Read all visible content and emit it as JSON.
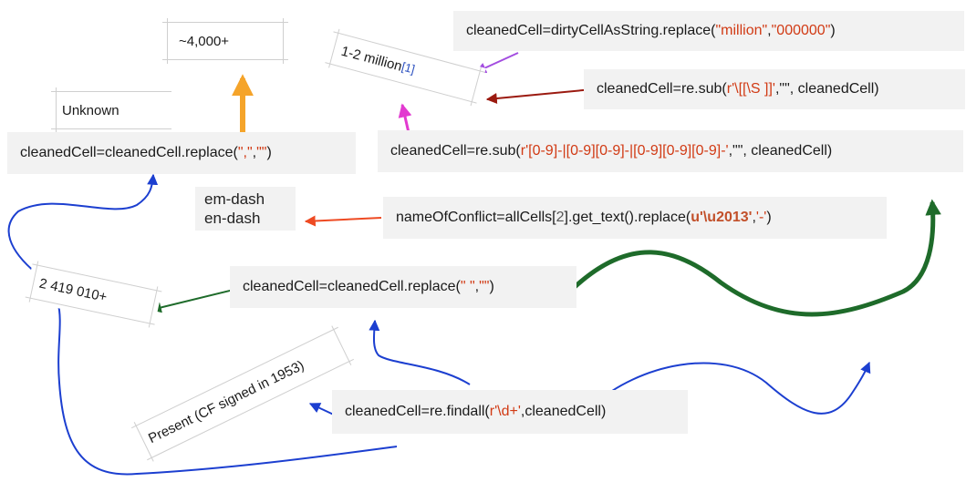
{
  "cells": {
    "approx": "~4,000+",
    "million": "1-2 million",
    "million_ref": "[1]",
    "unknown": "Unknown",
    "number": "2 419 010+",
    "present": "Present (CF signed in 1953)"
  },
  "dash_labels": {
    "em": "em-dash",
    "en": "en-dash"
  },
  "code": {
    "replace_million": {
      "pre": "cleanedCell=dirtyCellAsString.replace(",
      "a1": "\"million\"",
      "sep": ", ",
      "a2": "\"000000\"",
      "post": ")"
    },
    "re_sub_brackets": {
      "pre": "cleanedCell=re.sub(",
      "a1": "r'\\[[\\S ]]'",
      "sep": ",\"\", cleanedCell)"
    },
    "replace_comma": {
      "pre": "cleanedCell=cleanedCell.replace(",
      "a1": "\",\"",
      "sep": ", ",
      "a2": "\"\"",
      "post": ")"
    },
    "re_sub_digits": {
      "pre": "cleanedCell=re.sub(",
      "a1": "r'[0-9]-|[0-9][0-9]-|[0-9][0-9][0-9]-'",
      "sep": ",\"\", cleanedCell)"
    },
    "replace_dash": {
      "pre": "nameOfConflict=allCells[",
      "idx": "2",
      "mid": "].get_text().replace(",
      "a1": "u'\\u2013'",
      "sep": ", ",
      "a2": "'-'",
      "post": ")"
    },
    "replace_space": {
      "pre": "cleanedCell=cleanedCell.replace(",
      "a1": "\" \"",
      "sep": ", ",
      "a2": "\"\"",
      "post": ")"
    },
    "findall": {
      "pre": "cleanedCell=re.findall(",
      "a1": "r'\\d+'",
      "post": ",cleanedCell)"
    }
  },
  "colors": {
    "purple": "#a34de0",
    "darkred": "#9b1a10",
    "magenta": "#e23ad0",
    "orange": "#f5a42a",
    "orangered": "#ee4a22",
    "green": "#1e6b2a",
    "blue": "#1c3fd0",
    "string_red": "#d13a14"
  }
}
